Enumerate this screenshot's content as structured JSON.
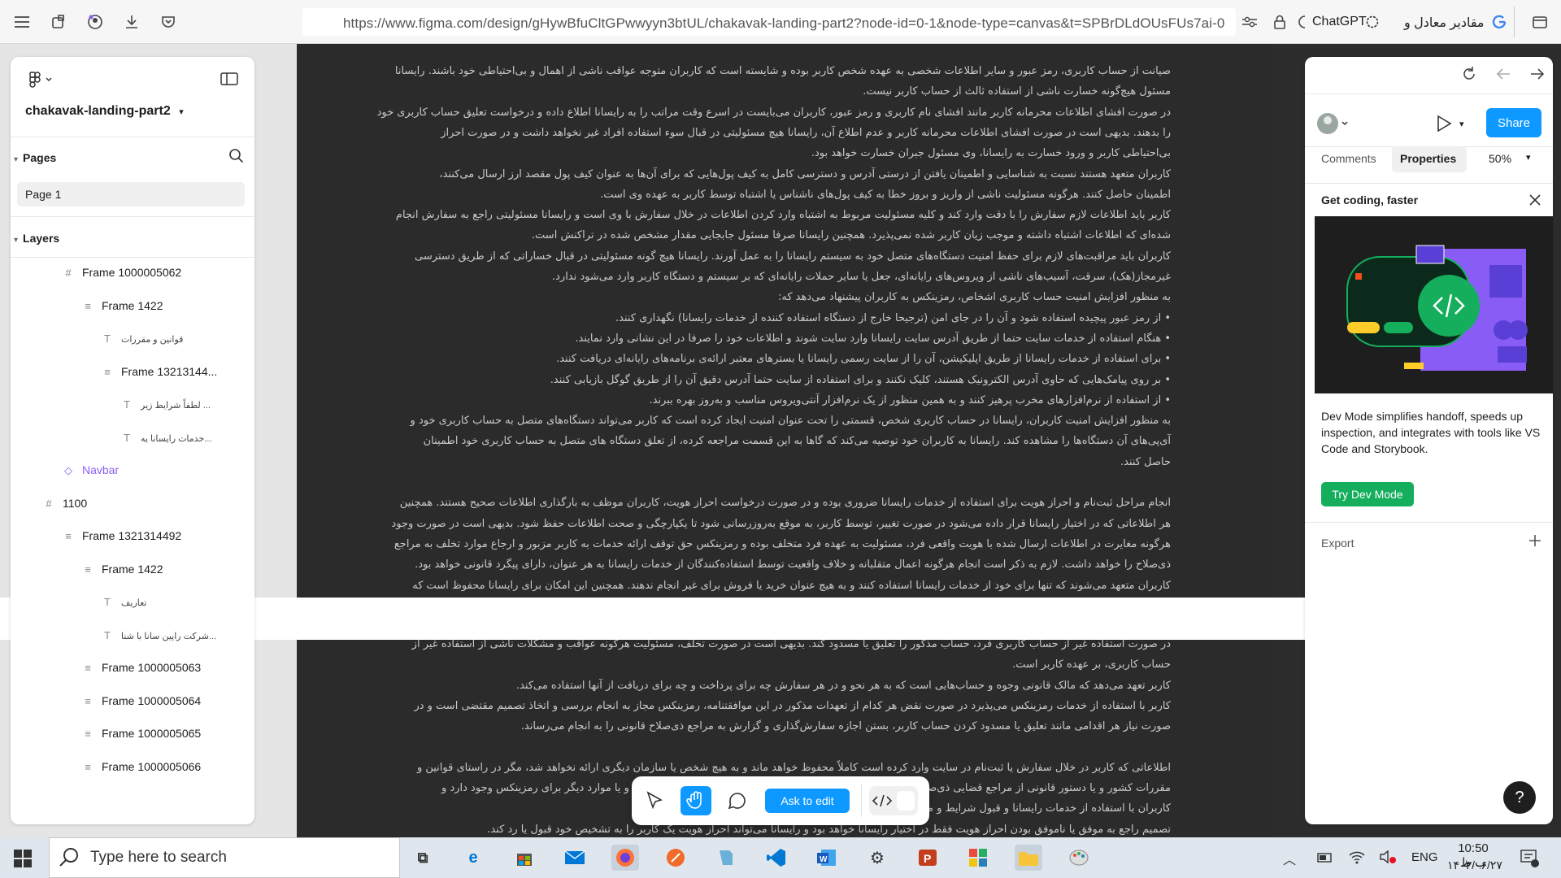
{
  "browser": {
    "url": "https://www.figma.com/design/gHywBfuCltGPwwyyn3btUL/chakavak-landing-part2?node-id=0-1&node-type=canvas&t=SPBrDLdOUsFUs7ai-0",
    "tab_chatgpt": "ChatGPT",
    "tab_search": "مقادیر معادل و"
  },
  "left_panel": {
    "file_name": "chakavak-landing-part2",
    "pages_label": "Pages",
    "page_item": "Page 1",
    "layers_label": "Layers",
    "layers": [
      {
        "icon": "#",
        "label": "Frame 1000005062"
      },
      {
        "icon": "≡",
        "label": "Frame 1422"
      },
      {
        "icon": "T",
        "label": "قوانین و مقررات"
      },
      {
        "icon": "≡",
        "label": "Frame 13213144..."
      },
      {
        "icon": "T",
        "label": "لطفاً شرایط زیر ..."
      },
      {
        "icon": "T",
        "label": "خدمات رایسانا یه..."
      },
      {
        "icon": "◇",
        "label": "Navbar"
      },
      {
        "icon": "#",
        "label": "1100"
      },
      {
        "icon": "≡",
        "label": "Frame 1321314492"
      },
      {
        "icon": "≡",
        "label": "Frame 1422"
      },
      {
        "icon": "T",
        "label": "تعاریف"
      },
      {
        "icon": "T",
        "label": "شرکت راپین سانا با شنا..."
      },
      {
        "icon": "≡",
        "label": "Frame 1000005063"
      },
      {
        "icon": "≡",
        "label": "Frame 1000005064"
      },
      {
        "icon": "≡",
        "label": "Frame 1000005065"
      },
      {
        "icon": "≡",
        "label": "Frame 1000005066"
      }
    ]
  },
  "right_panel": {
    "share_label": "Share",
    "tab_comments": "Comments",
    "tab_properties": "Properties",
    "zoom": "50%",
    "promo_title": "Get coding, faster",
    "promo_text": "Dev Mode simplifies handoff, speeds up inspection, and integrates with tools like VS Code and Storybook.",
    "promo_button": "Try Dev Mode",
    "export_label": "Export",
    "help_label": "?"
  },
  "toolbar": {
    "ask_label": "Ask to edit"
  },
  "document": {
    "block1": [
      "صیانت از حساب کاربری، رمز عبور و سایر اطلاعات شخصی به عهده شخص کاربر بوده و شایسته است که کاربران متوجه عواقب ناشی از اهمال و بی‌احتیاطی خود باشند. رایسانا",
      "مسئول هیچ‌گونه خسارت ناشی از استفاده ثالث از حساب کاربر نیست.",
      "در صورت افشای اطلاعات محرمانه کاربر مانند افشای نام کاربری و رمز عبور، کاربران می‌بایست در اسرع وقت مراتب را به رایسانا اطلاع داده و درخواست تعلیق حساب کاربری خود",
      "را بدهند. بدیهی است در صورت افشای اطلاعات محرمانه کاربر و عدم اطلاع آن، رایسانا هیچ مسئولیتی در قبال سوء استفاده افراد غیر نخواهد داشت و در صورت احراز",
      "بی‌احتیاطی کاربر و ورود خسارت به رایسانا، وی مسئول جبران خسارت خواهد بود.",
      "کاربران متعهد هستند نسبت به شناسایی و اطمینان یافتن از درستی آدرس و دسترسی کامل به کیف پول‌هایی که برای آن‌ها به عنوان کیف پول مقصد ارز ارسال می‌کنند،",
      "اطمینان حاصل کنند. هرگونه مسئولیت ناشی از واریز و بروز خطا به کیف پول‌های ناشناس یا اشتباه توسط کاربر به عهده وی است.",
      "کاربر باید اطلاعات لازم سفارش را با دقت وارد کند و کلیه مسئولیت مربوط به اشتباه وارد کردن اطلاعات در خلال سفارش با وی است و رایسانا مسئولیتی راجع به سفارش انجام",
      "شده‌ای که اطلاعات اشتباه داشته و موجب زیان کاربر شده نمی‌پذیرد. همچنین رایسانا صرفا مسئول جابجایی مقدار مشخص شده در تراکنش است.",
      "کاربران باید مراقبت‌های لازم برای حفظ امنیت دستگاه‌های متصل خود به سیستم رایسانا را به عمل آورند. رایسانا هیچ گونه مسئولیتی در قبال خساراتی که از طریق دسترسی",
      "غیرمجاز(هک)، سرقت، آسیب‌های ناشی از ویروس‌های رایانه‌ای، جعل یا سایر حملات رایانه‌ای که بر سیستم و دستگاه کاربر وارد می‌شود ندارد.",
      "به منظور افزایش امنیت حساب کاربری اشخاص، رمزینکس به کاربران پیشنهاد می‌دهد که:",
      "• از رمز عبور پیچیده استفاده شود و آن را در جای امن (ترجیحا خارج از دستگاه استفاده کننده از خدمات رایسانا) نگهداری کنند.",
      "• هنگام استفاده از خدمات سایت حتما از طریق آدرس سایت رایسانا وارد سایت شوند و اطلاعات خود را صرفا در این نشانی وارد نمایند.",
      "• برای استفاده از خدمات رایسانا از طریق اپلیکیشن، آن را از سایت رسمی رایسانا یا بسترهای معتبر ارائه‌ی برنامه‌های رایانه‌ای دریافت کنند.",
      "• بر روی پیامک‌هایی که حاوی آدرس الکترونیک هستند، کلیک نکنند و برای استفاده از سایت حتما آدرس دقیق آن را از طریق گوگل بازیابی کنند.",
      "• از استفاده از نرم‌افزارهای مخرب پرهیز کنند و به همین منظور از یک نرم‌افزار آنتی‌ویروس مناسب و به‌روز بهره ببرند.",
      "به منظور افزایش امنیت کاربران، رایسانا در حساب کاربری شخص، قسمتی را تحت عنوان امنیت ایجاد کرده است که کاربر می‌تواند دستگاه‌های متصل به حساب کاربری خود و",
      "آی‌پی‌های آن دستگاه‌ها را مشاهده کند. رایسانا به کاربران خود توصیه می‌کند که گاها به این قسمت مراجعه کرده، از تعلق دستگاه های متصل به حساب کاربری خود اطمینان",
      "حاصل کنند.",
      "",
      "انجام مراحل ثبت‌نام و احراز هویت برای استفاده از خدمات رایسانا ضروری بوده و در صورت درخواست احراز هویت، کاربران موظف به بارگذاری اطلاعات صحیح هستند. همچنین",
      "هر اطلاعاتی که در اختیار رایسانا قرار داده می‌شود در صورت تغییر، توسط کاربر، به موقع به‌روزرسانی شود تا یکپارچگی و صحت اطلاعات حفظ شود. بدیهی است در صورت وجود",
      "هرگونه مغایرت در اطلاعات ارسال شده با هویت واقعی فرد، مسئولیت به عهده فرد متخلف بوده و رمزینکس حق توقف ارائه خدمات به کاربر مزبور و ارجاع موارد تخلف به مراجع",
      "ذی‌صلاح را خواهد داشت. لازم به ذکر است انجام هرگونه اعمال متقلبانه و خلاف واقعیت توسط استفاده‌کنندگان از خدمات رایسانا به هر عنوان، دارای پیگرد قانونی خواهد بود.",
      "کاربران متعهد می‌شوند که تنها برای خود از خدمات رایسانا استفاده کنند و به هیچ عنوان خرید یا فروش برای غیر انجام ندهند. همچنین این امکان برای رایسانا محفوظ است که"
    ],
    "block2": [
      "در صورت استفاده غیر از حساب کاربری فرد، حساب مذکور را تعلیق یا مسدود کند. بدیهی است در صورت تخلف، مسئولیت هرگونه عواقب و مشکلات ناشی از استفاده غیر از",
      "حساب کاربری، بر عهده کاربر است.",
      "کاربر تعهد می‌دهد که مالک قانونی وجوه و حساب‌هایی است که به هر نحو و در هر سفارش چه برای پرداخت و چه برای دریافت از آنها استفاده می‌کند.",
      "کاربر با استفاده از خدمات رمزینکس می‌پذیرد در صورت نقض هر کدام از تعهدات مذکور در این موافقتنامه، رمزینکس مجاز به انجام بررسی و اتخاذ تصمیم مقتضی است و در",
      "صورت نیاز هر اقدامی مانند تعلیق یا مسدود کردن حساب کاربر، بستن اجازه سفارش‌گذاری و گزارش به مراجع ذی‌صلاح قانونی را به انجام می‌رساند.",
      "",
      "اطلاعاتی که کاربر در خلال سفارش یا ثبت‌نام در سایت وارد کرده است کاملاً محفوظ خواهد ماند و به هیچ شخص یا سازمان دیگری ارائه نخواهد شد، مگر در راستای قوانین و",
      "مقررات کشور و یا دستور قانونی از مراجع قضایی ذی‌صلاح که در این صورت رایسانا ملزم به ارائه اطلاعات کاربر خواهد بود و یا موارد دیگر برای رمزینکس وجود دارد و",
      "کاربران با استفاده از خدمات رایسانا و قبول شرایط و مقررات موافقت خود را اعلام می‌دارند.",
      "تصمیم راجع به موفق یا ناموفق بودن احراز هویت فقط در اختیار رایسانا خواهد بود و رایسانا می‌تواند احراز هویت یک کاربر را به تشخیص خود قبول یا رد کند."
    ]
  },
  "taskbar": {
    "search_placeholder": "Type here to search",
    "lang": "ENG",
    "time": "10:50 ب.ظ",
    "date": "۱۴۰۳/۰۶/۲۷"
  }
}
